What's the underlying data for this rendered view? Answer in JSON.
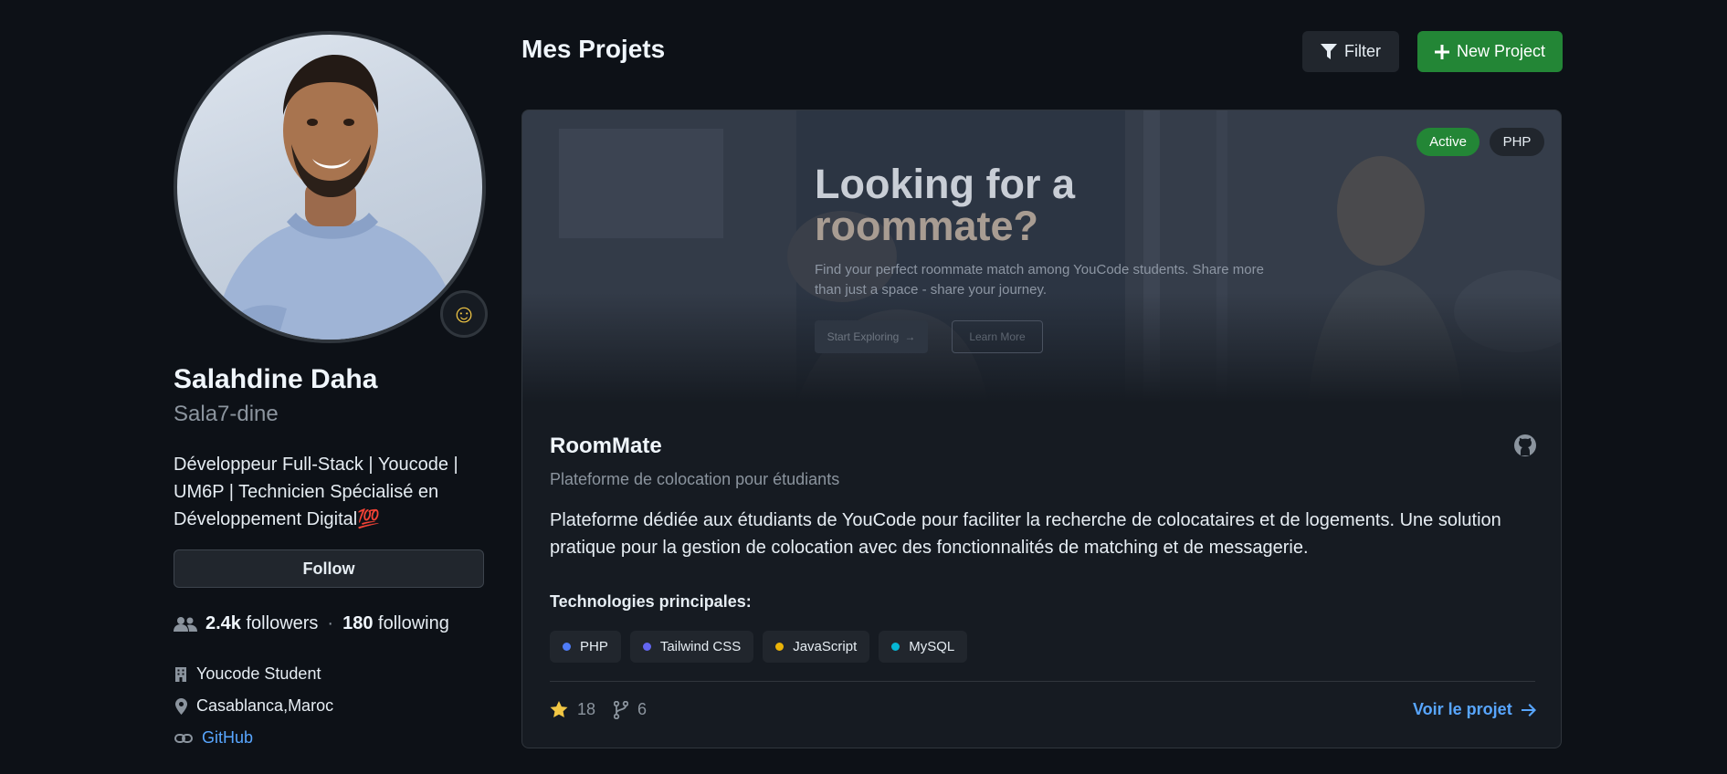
{
  "profile": {
    "name": "Salahdine Daha",
    "username": "Sala7-dine",
    "bio": "Développeur Full-Stack | Youcode | UM6P | Technicien Spécialisé en Développement Digital💯",
    "status_emoji": "☺",
    "follow_label": "Follow",
    "followers_count": "2.4k",
    "followers_label": "followers",
    "separator": "·",
    "following_count": "180",
    "following_label": "following",
    "organization": "Youcode Student",
    "location": "Casablanca,Maroc",
    "link_label": "GitHub"
  },
  "header": {
    "title": "Mes Projets",
    "filter_label": "Filter",
    "new_project_label": "New Project"
  },
  "project": {
    "hero": {
      "title_line1": "Looking for a",
      "title_line2": "roommate?",
      "subtitle": "Find your perfect roommate match among YouCode students. Share more than just a space - share your journey.",
      "primary_button": "Start Exploring",
      "secondary_button": "Learn More"
    },
    "status_badge": "Active",
    "language_badge": "PHP",
    "title": "RoomMate",
    "subtitle": "Plateforme de colocation pour étudiants",
    "description": "Plateforme dédiée aux étudiants de YouCode pour faciliter la recherche de colocataires et de logements. Une solution pratique pour la gestion de colocation avec des fonctionnalités de matching et de messagerie.",
    "tech_label": "Technologies principales:",
    "technologies": [
      {
        "name": "PHP",
        "color": "#4f7cf7"
      },
      {
        "name": "Tailwind CSS",
        "color": "#6366f1"
      },
      {
        "name": "JavaScript",
        "color": "#eab308"
      },
      {
        "name": "MySQL",
        "color": "#06b6d4"
      }
    ],
    "stars": "18",
    "forks": "6",
    "view_label": "Voir le projet"
  },
  "colors": {
    "accent_green": "#238636",
    "link_blue": "#58a6ff",
    "star_yellow": "#f2c744"
  }
}
